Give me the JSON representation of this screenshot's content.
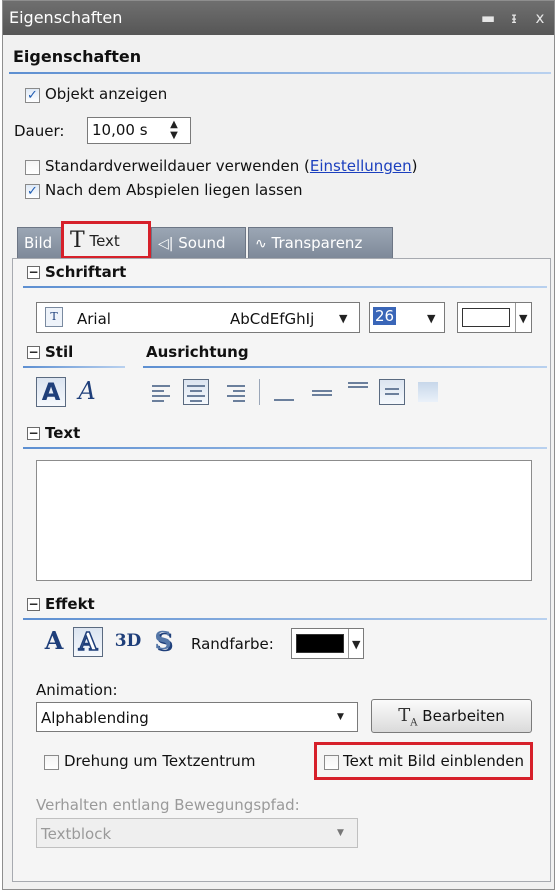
{
  "window": {
    "title": "Eigenschaften",
    "buttons": [
      "▬",
      "ᵻ",
      "x"
    ]
  },
  "header": {
    "title": "Eigenschaften"
  },
  "object": {
    "show_label": "Objekt anzeigen",
    "duration_label": "Dauer:",
    "duration_value": "10,00 s",
    "default_duration_label": "Standardverweildauer verwenden (",
    "settings_link": "Einstellungen",
    "close_paren": ")",
    "keep_after_play_label": "Nach dem Abspielen liegen lassen"
  },
  "tabs": [
    {
      "label": "Bild",
      "active": false
    },
    {
      "label": "Text",
      "active": true
    },
    {
      "label": "Sound",
      "active": false
    },
    {
      "label": "Transparenz",
      "active": false
    }
  ],
  "font": {
    "heading": "Schriftart",
    "name": "Arial",
    "preview": "AbCdEfGhIj",
    "size": "26",
    "color": "#ffffff"
  },
  "style": {
    "heading": "Stil",
    "align_heading": "Ausrichtung",
    "bold_glyph": "A",
    "italic_glyph": "A"
  },
  "text_section": {
    "heading": "Text",
    "value": ""
  },
  "effect": {
    "heading": "Effekt",
    "glyph_plain": "A",
    "glyph_3d": "3D",
    "glyph_shadow": "S",
    "border_color_label": "Randfarbe:",
    "border_color": "#000000",
    "animation_label": "Animation:",
    "animation_value": "Alphablending",
    "edit_button": "Bearbeiten",
    "rotate_label": "Drehung um Textzentrum",
    "show_with_image_label": "Text mit Bild einblenden",
    "path_label": "Verhalten entlang Bewegungspfad:",
    "path_value": "Textblock"
  },
  "colors": {
    "accent_red": "#d6202a",
    "section_line": "#5d8fd1",
    "link": "#1b3fbe"
  }
}
